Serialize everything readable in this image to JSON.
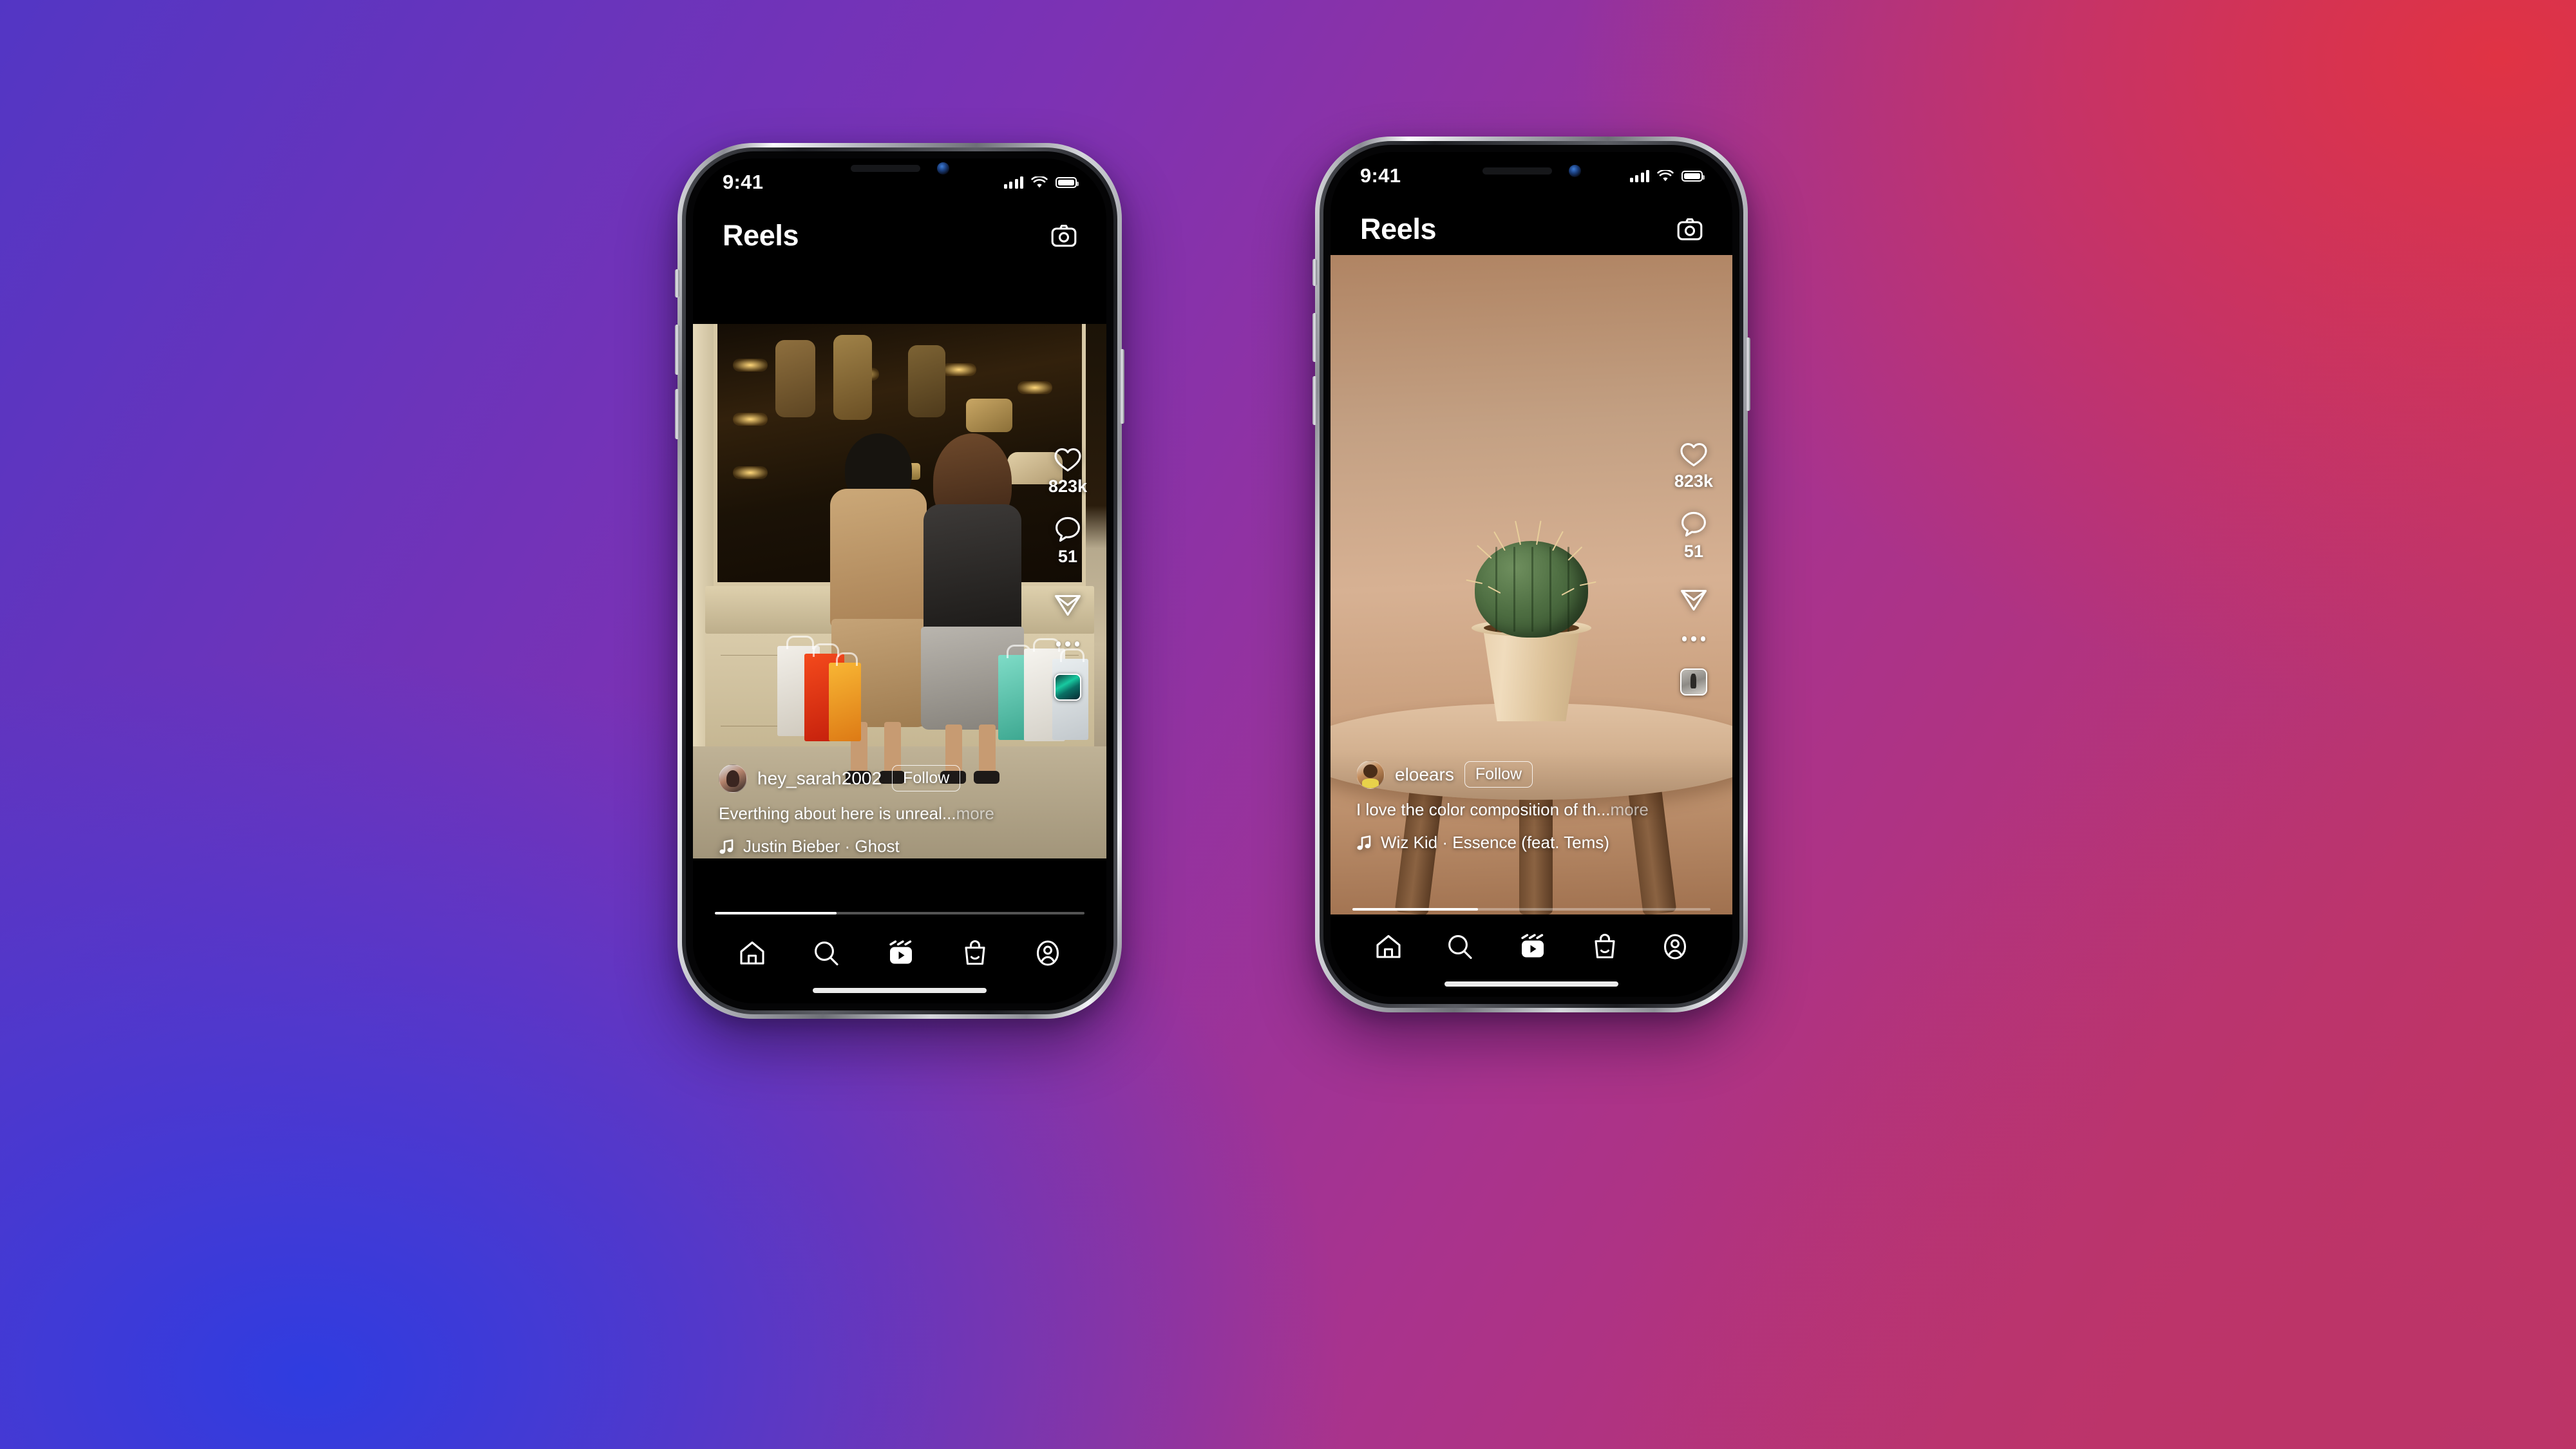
{
  "background": {
    "gradient_colors": [
      "#5336c4",
      "#7c32b4",
      "#a8338e",
      "#c93458",
      "#2f3ce0",
      "#e03344",
      "#bb3469"
    ]
  },
  "phones": [
    {
      "id": "left",
      "notch_style": "dynamic-island",
      "status_bar": {
        "time": "9:41",
        "icons": [
          "signal-bars-icon",
          "wifi-icon",
          "battery-icon"
        ]
      },
      "app_header": {
        "title": "Reels",
        "camera_icon": "camera-icon"
      },
      "media": {
        "type": "photo",
        "description": "two women with shopping bags in front of boutique window",
        "letterboxed": true
      },
      "actions": {
        "like_icon": "heart-icon",
        "like_count": "823k",
        "comment_icon": "comment-bubble-icon",
        "comment_count": "51",
        "share_icon": "paper-plane-icon",
        "more_icon": "more-options-icon",
        "album_art": "album-art-thumbnail"
      },
      "post": {
        "username": "hey_sarah2002",
        "follow_label": "Follow",
        "caption": "Everthing about here is unreal...",
        "more_label": "more",
        "music_icon": "music-note-icon",
        "music": "Justin Bieber · Ghost"
      },
      "progress_percent": 33,
      "tab_bar": {
        "items": [
          {
            "name": "home",
            "icon": "home-icon",
            "active": false
          },
          {
            "name": "search",
            "icon": "search-icon",
            "active": false
          },
          {
            "name": "reels",
            "icon": "reels-icon",
            "active": true
          },
          {
            "name": "shop",
            "icon": "shopping-bag-icon",
            "active": false
          },
          {
            "name": "profile",
            "icon": "profile-icon",
            "active": false
          }
        ]
      }
    },
    {
      "id": "right",
      "notch_style": "classic-notch",
      "status_bar": {
        "time": "9:41",
        "icons": [
          "signal-bars-icon",
          "wifi-icon",
          "battery-icon"
        ]
      },
      "app_header": {
        "title": "Reels",
        "camera_icon": "camera-icon"
      },
      "media": {
        "type": "photo",
        "description": "barrel cactus in cream pot on round wooden stool, tan background",
        "letterboxed": false
      },
      "actions": {
        "like_icon": "heart-icon",
        "like_count": "823k",
        "comment_icon": "comment-bubble-icon",
        "comment_count": "51",
        "share_icon": "paper-plane-icon",
        "more_icon": "more-options-icon",
        "album_art": "album-art-thumbnail"
      },
      "post": {
        "username": "eloears",
        "follow_label": "Follow",
        "caption": "I love the color composition of th...",
        "more_label": "more",
        "music_icon": "music-note-icon",
        "music": "Wiz Kid · Essence (feat. Tems)"
      },
      "progress_percent": 35,
      "tab_bar": {
        "items": [
          {
            "name": "home",
            "icon": "home-icon",
            "active": false
          },
          {
            "name": "search",
            "icon": "search-icon",
            "active": false
          },
          {
            "name": "reels",
            "icon": "reels-icon",
            "active": true
          },
          {
            "name": "shop",
            "icon": "shopping-bag-icon",
            "active": false
          },
          {
            "name": "profile",
            "icon": "profile-icon",
            "active": false
          }
        ]
      }
    }
  ]
}
